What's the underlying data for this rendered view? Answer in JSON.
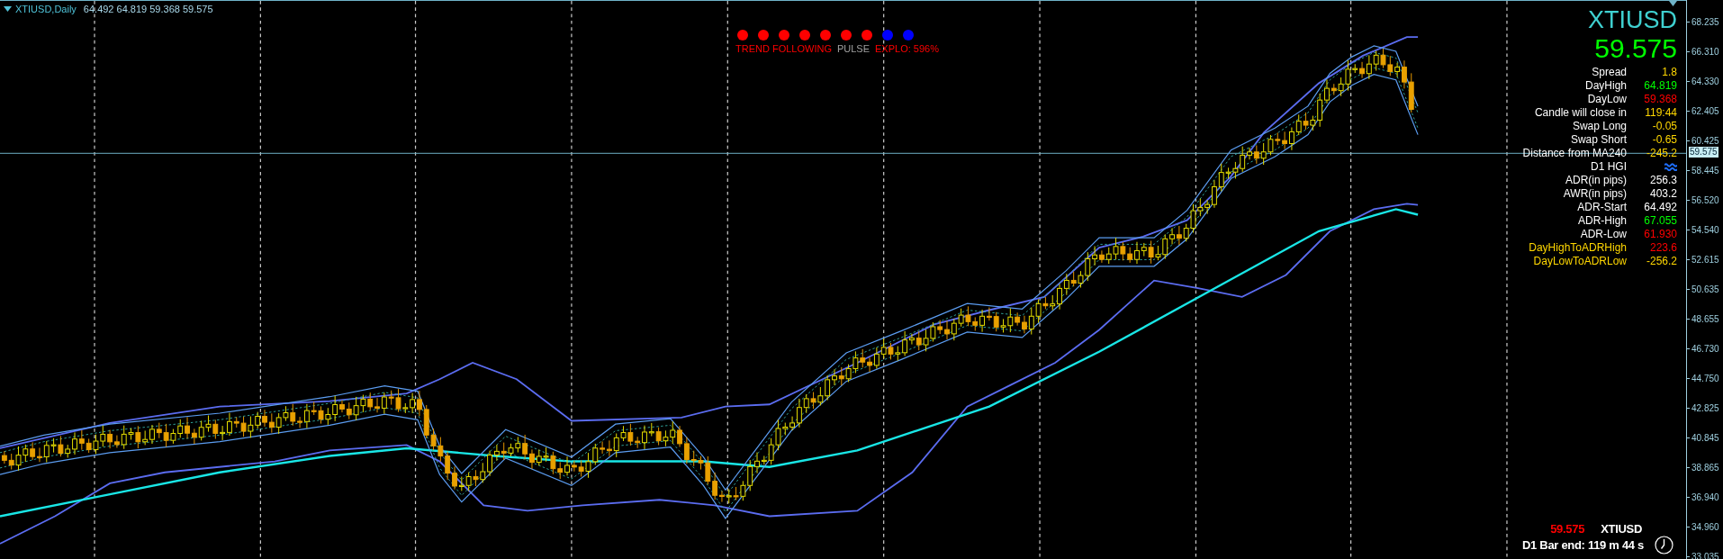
{
  "window": {
    "symbol_title": "XTIUSD,Daily",
    "ohlc": "64.492 64.819 59.368 59.575"
  },
  "signals": {
    "dots": [
      {
        "color": "#ff0000"
      },
      {
        "color": "#ff0000"
      },
      {
        "color": "#ff0000"
      },
      {
        "color": "#ff0000"
      },
      {
        "color": "#ff0000"
      },
      {
        "color": "#ff0000"
      },
      {
        "color": "#ff0000"
      },
      {
        "color": "#0000ff"
      },
      {
        "color": "#0000ff"
      }
    ],
    "trend": "TREND FOLLOWING",
    "pulse": "PULSE",
    "explo": "EXPLO: 596%"
  },
  "info_panel": {
    "symbol": "XTIUSD",
    "price": "59.575",
    "rows": [
      {
        "kind": "text",
        "label": "Spread",
        "value": "1.8",
        "highlighted": false,
        "color": "#ffd700"
      },
      {
        "kind": "text",
        "label": "DayHigh",
        "value": "64.819",
        "highlighted": false,
        "color": "#00ff00"
      },
      {
        "kind": "text",
        "label": "DayLow",
        "value": "59.368",
        "highlighted": false,
        "color": "#ff0000"
      },
      {
        "kind": "text",
        "label": "Candle will close in",
        "value": "119:44",
        "highlighted": false,
        "color": "#ffd700"
      },
      {
        "kind": "text",
        "label": "Swap Long",
        "value": "-0.05",
        "highlighted": false,
        "color": "#ffd700"
      },
      {
        "kind": "text",
        "label": "Swap Short",
        "value": "-0.65",
        "highlighted": false,
        "color": "#ffd700"
      },
      {
        "kind": "text",
        "label": "Distance from MA240",
        "value": "-245.2",
        "highlighted": false,
        "color": "#ffd700"
      },
      {
        "kind": "icon",
        "label": "D1 HGI",
        "highlighted": false,
        "color": "#1e6fff"
      },
      {
        "kind": "text",
        "label": "ADR(in pips)",
        "value": "256.3",
        "highlighted": false,
        "color": "#ffffff"
      },
      {
        "kind": "text",
        "label": "AWR(in pips)",
        "value": "403.2",
        "highlighted": false,
        "color": "#ffffff"
      },
      {
        "kind": "text",
        "label": "ADR-Start",
        "value": "64.492",
        "highlighted": false,
        "color": "#ffffff"
      },
      {
        "kind": "text",
        "label": "ADR-High",
        "value": "67.055",
        "highlighted": false,
        "color": "#00ff00"
      },
      {
        "kind": "text",
        "label": "ADR-Low",
        "value": "61.930",
        "highlighted": false,
        "color": "#ff0000"
      },
      {
        "kind": "text",
        "label": "DayHighToADRHigh",
        "value": "223.6",
        "highlighted": true,
        "color": "#ff0000"
      },
      {
        "kind": "text",
        "label": "DayLowToADRLow",
        "value": "-256.2",
        "highlighted": true,
        "color": "#ffd700"
      }
    ]
  },
  "price_axis": {
    "ticks": [
      "68.235",
      "66.310",
      "64.330",
      "62.405",
      "60.425",
      "58.445",
      "56.520",
      "54.540",
      "52.615",
      "50.635",
      "48.655",
      "46.730",
      "44.750",
      "42.825",
      "40.845",
      "38.865",
      "36.940",
      "34.960",
      "33.035"
    ],
    "current_price": "59.575"
  },
  "bar_timer": {
    "price": "59.575",
    "symbol": "XTIUSD",
    "countdown": "D1 Bar end: 119 m 44 s"
  }
}
